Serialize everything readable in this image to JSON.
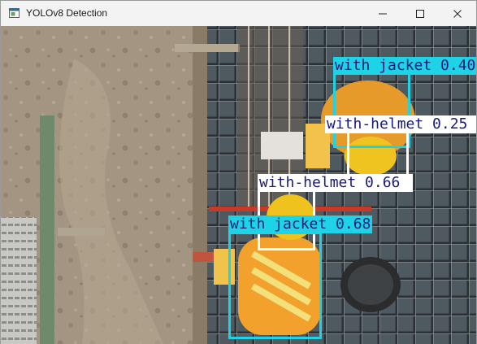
{
  "window": {
    "title": "YOLOv8 Detection",
    "icons": [
      "app-window-icon",
      "minimize-icon",
      "maximize-icon",
      "close-icon"
    ]
  },
  "colors": {
    "jacket_class": "#1ed3e6",
    "helmet_class": "#ffffff",
    "jacket_label_text": "#1a1a7a",
    "helmet_label_text": "#1a1a7a"
  },
  "detections": [
    {
      "class": "with jacket",
      "confidence": "0.40",
      "label": "with jacket 0.40"
    },
    {
      "class": "with-helmet",
      "confidence": "0.25",
      "label": "with-helmet 0.25"
    },
    {
      "class": "with-helmet",
      "confidence": "0.66",
      "label": "with-helmet 0.66"
    },
    {
      "class": "with jacket",
      "confidence": "0.68",
      "label": "with jacket 0.68"
    }
  ]
}
